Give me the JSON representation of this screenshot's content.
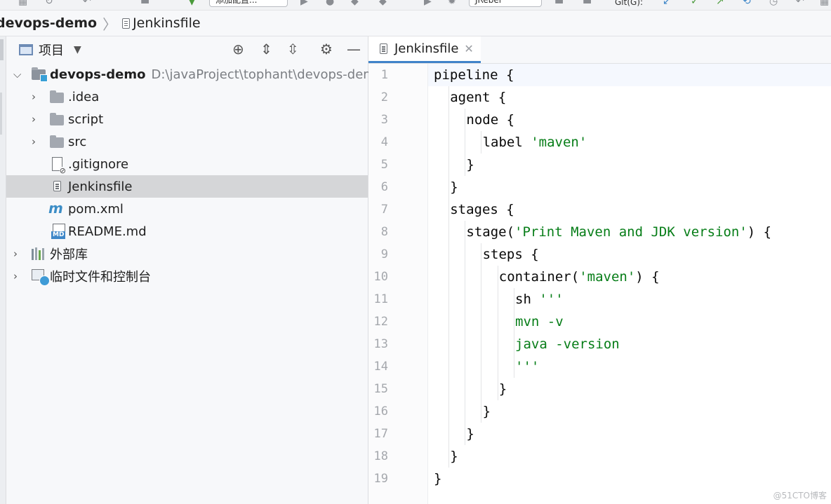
{
  "toolbar": {
    "config_label": "添加配置...",
    "plugin_label": "JRebel",
    "git_label": "Git(G):"
  },
  "breadcrumb": {
    "project": "devops-demo",
    "file": "Jenkinsfile"
  },
  "project_panel": {
    "title": "项目",
    "tree": [
      {
        "type": "module",
        "label": "devops-demo",
        "path": "D:\\javaProject\\tophant\\devops-demo",
        "expanded": true,
        "icon": "module-folder-icon"
      },
      {
        "type": "folder",
        "label": ".idea",
        "icon": "folder-icon"
      },
      {
        "type": "folder",
        "label": "script",
        "icon": "folder-icon"
      },
      {
        "type": "folder",
        "label": "src",
        "icon": "folder-icon"
      },
      {
        "type": "file",
        "label": ".gitignore",
        "icon": "gitignore-file-icon"
      },
      {
        "type": "file",
        "label": "Jenkinsfile",
        "icon": "text-file-icon",
        "selected": true
      },
      {
        "type": "file",
        "label": "pom.xml",
        "icon": "maven-icon"
      },
      {
        "type": "file",
        "label": "README.md",
        "icon": "markdown-file-icon"
      },
      {
        "type": "folder",
        "label": "外部库",
        "icon": "library-icon"
      },
      {
        "type": "folder",
        "label": "临时文件和控制台",
        "icon": "scratches-icon"
      }
    ]
  },
  "editor": {
    "tab_label": "Jenkinsfile",
    "lines": [
      {
        "n": "1",
        "indent": 0,
        "pre": "pipeline {",
        "str": "",
        "post": ""
      },
      {
        "n": "2",
        "indent": 1,
        "pre": "agent {",
        "str": "",
        "post": ""
      },
      {
        "n": "3",
        "indent": 2,
        "pre": "node {",
        "str": "",
        "post": ""
      },
      {
        "n": "4",
        "indent": 3,
        "pre": "label ",
        "str": "'maven'",
        "post": ""
      },
      {
        "n": "5",
        "indent": 2,
        "pre": "}",
        "str": "",
        "post": ""
      },
      {
        "n": "6",
        "indent": 1,
        "pre": "}",
        "str": "",
        "post": ""
      },
      {
        "n": "7",
        "indent": 1,
        "pre": "stages {",
        "str": "",
        "post": ""
      },
      {
        "n": "8",
        "indent": 2,
        "pre": "stage(",
        "str": "'Print Maven and JDK version'",
        "post": ") {"
      },
      {
        "n": "9",
        "indent": 3,
        "pre": "steps {",
        "str": "",
        "post": ""
      },
      {
        "n": "10",
        "indent": 4,
        "pre": "container(",
        "str": "'maven'",
        "post": ") {"
      },
      {
        "n": "11",
        "indent": 5,
        "pre": "sh ",
        "str": "'''",
        "post": ""
      },
      {
        "n": "12",
        "indent": 5,
        "pre": "",
        "str": "mvn -v",
        "post": ""
      },
      {
        "n": "13",
        "indent": 5,
        "pre": "",
        "str": "java -version",
        "post": ""
      },
      {
        "n": "14",
        "indent": 5,
        "pre": "",
        "str": "'''",
        "post": ""
      },
      {
        "n": "15",
        "indent": 4,
        "pre": "}",
        "str": "",
        "post": ""
      },
      {
        "n": "16",
        "indent": 3,
        "pre": "}",
        "str": "",
        "post": ""
      },
      {
        "n": "17",
        "indent": 2,
        "pre": "}",
        "str": "",
        "post": ""
      },
      {
        "n": "18",
        "indent": 1,
        "pre": "}",
        "str": "",
        "post": ""
      },
      {
        "n": "19",
        "indent": 0,
        "pre": "}",
        "str": "",
        "post": ""
      }
    ]
  },
  "watermark": "@51CTO博客"
}
